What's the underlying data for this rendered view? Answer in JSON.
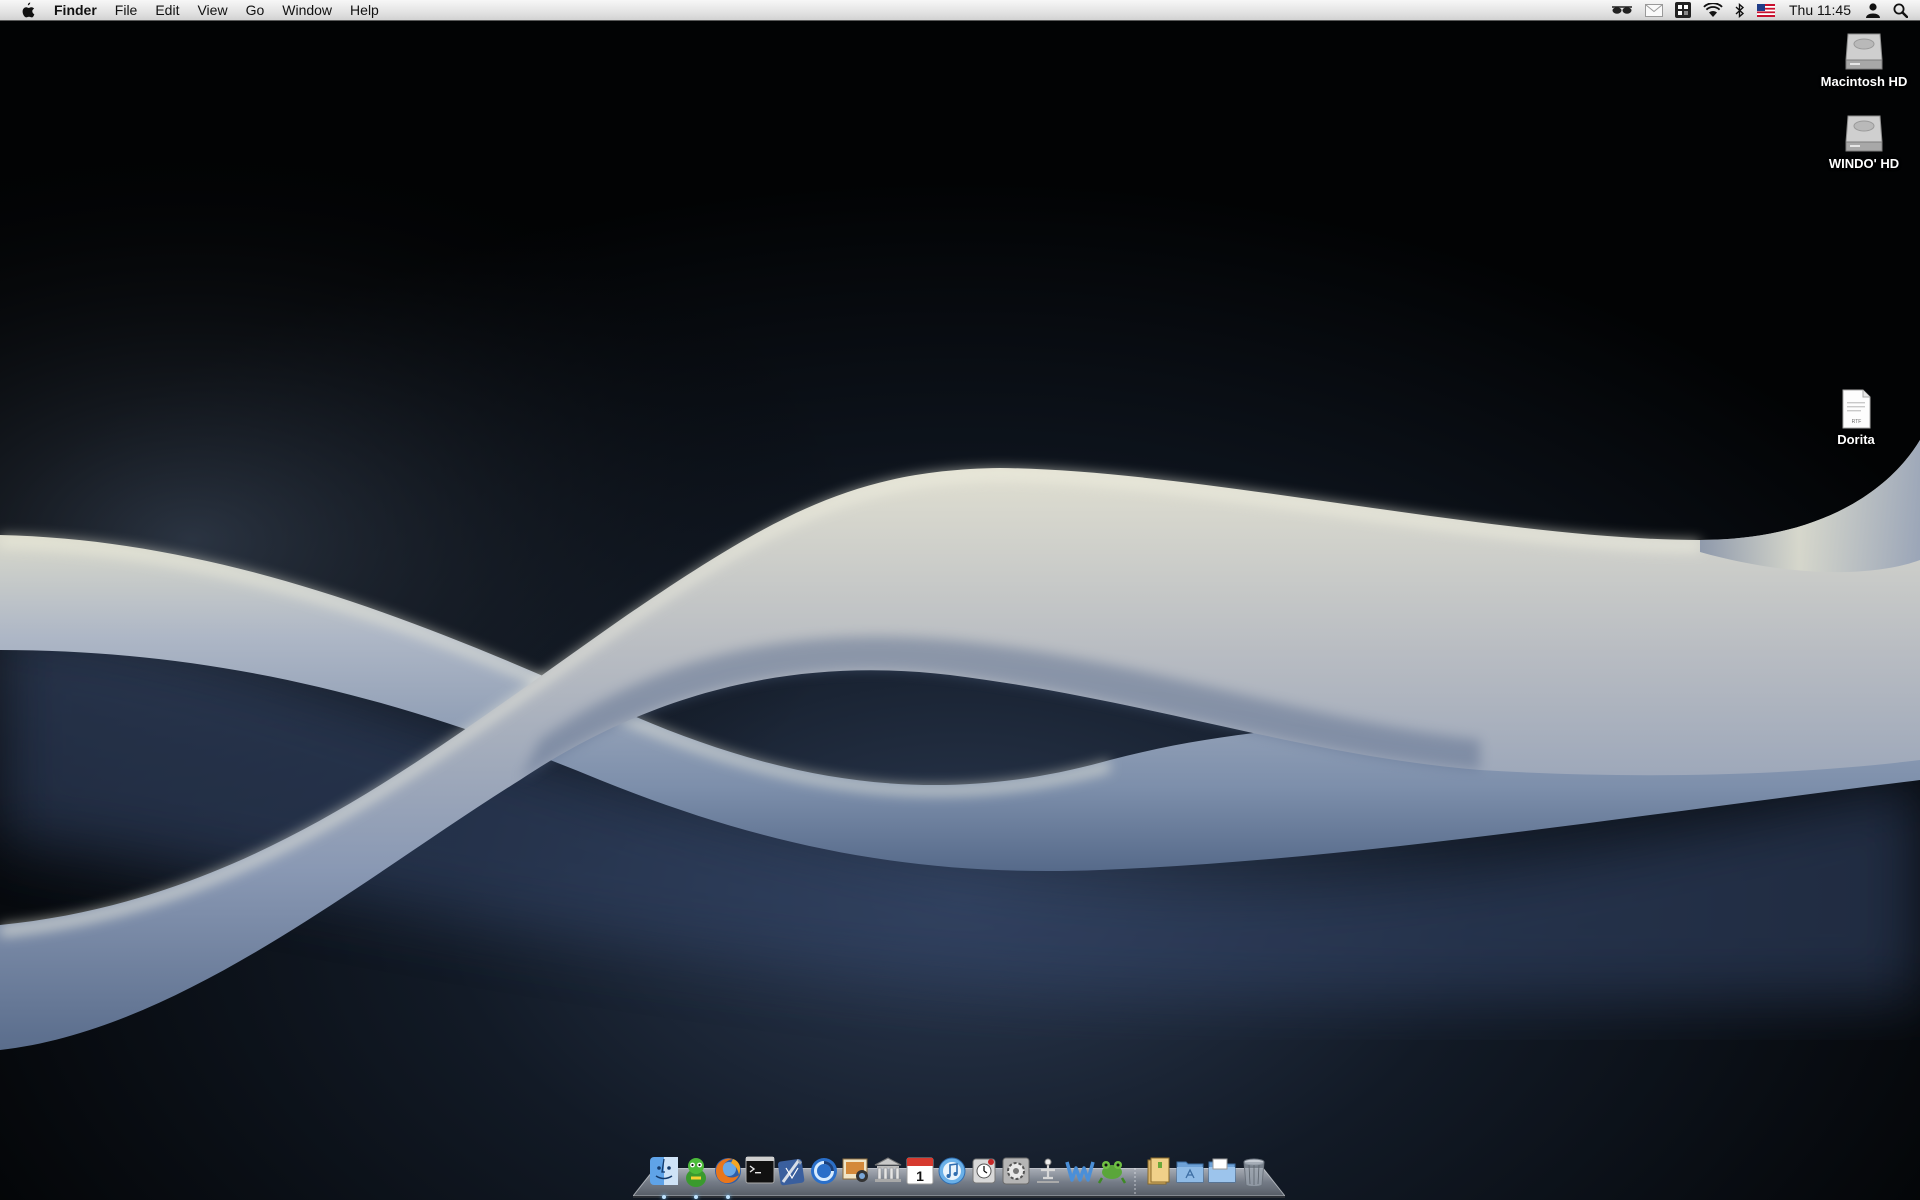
{
  "menubar": {
    "app_name": "Finder",
    "menus": [
      "File",
      "Edit",
      "View",
      "Go",
      "Window",
      "Help"
    ],
    "clock": "Thu 11:45",
    "status_icons": [
      "glasses-icon",
      "mail-icon",
      "menu-extra-icon",
      "wifi-icon",
      "bluetooth-icon",
      "flag-icon",
      "user-icon",
      "spotlight-icon"
    ]
  },
  "desktop": {
    "icons": [
      {
        "label": "Macintosh HD",
        "icon": "hard-drive-icon"
      },
      {
        "label": "WINDO' HD",
        "icon": "hard-drive-icon"
      },
      {
        "label": "Dorita",
        "icon": "rtf-document-icon"
      }
    ],
    "rtf_badge": "RTF"
  },
  "dock": {
    "items": [
      {
        "icon": "finder-icon",
        "running": true
      },
      {
        "icon": "adium-icon",
        "running": true
      },
      {
        "icon": "firefox-icon",
        "running": true
      },
      {
        "icon": "terminal-icon",
        "running": false
      },
      {
        "icon": "xcode-icon",
        "running": false
      },
      {
        "icon": "lasso-icon",
        "running": false
      },
      {
        "icon": "image-capture-icon",
        "running": false
      },
      {
        "icon": "library-icon",
        "running": false
      },
      {
        "icon": "calendar-icon",
        "running": false
      },
      {
        "icon": "itunes-icon",
        "running": false
      },
      {
        "icon": "time-machine-icon",
        "running": false
      },
      {
        "icon": "system-preferences-icon",
        "running": false
      },
      {
        "icon": "directory-utility-icon",
        "running": false
      },
      {
        "icon": "word-icon",
        "running": false
      },
      {
        "icon": "frog-icon",
        "running": false
      },
      {
        "icon": "archive-icon",
        "running": false
      },
      {
        "icon": "applications-folder-icon",
        "running": false
      },
      {
        "icon": "downloads-folder-icon",
        "running": false
      },
      {
        "icon": "trash-icon",
        "running": false
      }
    ],
    "calendar_day": "1"
  },
  "colors": {
    "wave_highlight": "#e4e3d4",
    "wave_mid": "#a2acbc",
    "wave_shadow": "#5c6f8e",
    "background": "#020304"
  }
}
